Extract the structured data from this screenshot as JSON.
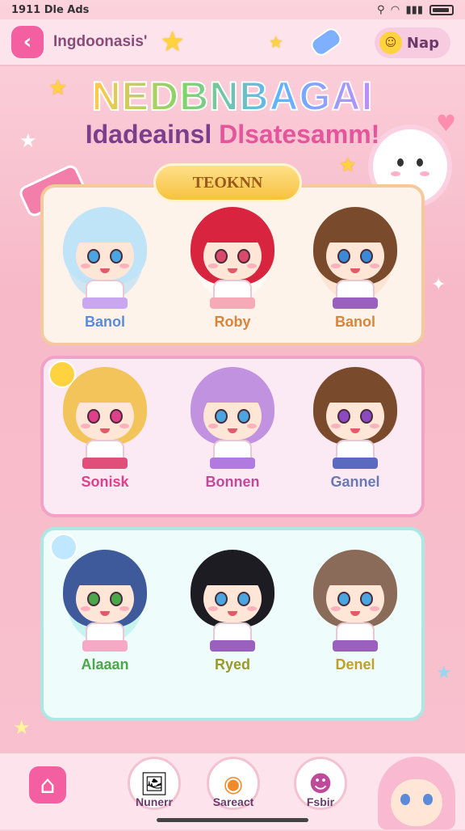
{
  "status": {
    "time": "1911 Dle Ads"
  },
  "topbar": {
    "app_name": "Ingdoonasis'",
    "nap_label": "Nap",
    "back_icon": "back-arrow-icon"
  },
  "titles": {
    "main": "NEDBNBAGAI",
    "sub_a": "Idadeainsl",
    "sub_b": "Dlsatesamm!"
  },
  "panel1": {
    "tag": "TEOKNN"
  },
  "characters": {
    "row1": [
      {
        "name": "Banol",
        "hair": "#bfe3f7",
        "eye": "#4aa6e0",
        "skirt": "#c8a7f0",
        "color": "#5a8ad8",
        "glow": "#a9d8f5"
      },
      {
        "name": "Roby",
        "hair": "#d8243f",
        "eye": "#d94a6a",
        "skirt": "#f6a9b6",
        "color": "#d8843a",
        "glow": "#ffffff"
      },
      {
        "name": "Banol",
        "hair": "#7a4a2c",
        "eye": "#3a8ad8",
        "skirt": "#9a60c0",
        "color": "#d8843a",
        "glow": "#ffd8c0"
      }
    ],
    "row2": [
      {
        "name": "Sonisk",
        "hair": "#f2c45a",
        "eye": "#e0408a",
        "skirt": "#e04f7a",
        "color": "#e0408a"
      },
      {
        "name": "Bonnen",
        "hair": "#c192e0",
        "eye": "#4aa6e0",
        "skirt": "#b07ae0",
        "color": "#c04a9a"
      },
      {
        "name": "Gannel",
        "hair": "#7a4a2c",
        "eye": "#8a4ac0",
        "skirt": "#5a6ac0",
        "color": "#6a7ab0"
      }
    ],
    "row3": [
      {
        "name": "Alaaan",
        "hair": "#3f5a9a",
        "eye": "#4aa84a",
        "skirt": "#f6a9c4",
        "color": "#4aa84a",
        "glow": "#a9ece8"
      },
      {
        "name": "Ryed",
        "hair": "#1c1c22",
        "eye": "#4aa6e0",
        "skirt": "#9a60c0",
        "color": "#9a9a2a"
      },
      {
        "name": "Denel",
        "hair": "#8a6a58",
        "eye": "#4aa6e0",
        "skirt": "#9a60c0",
        "color": "#c0a02a"
      }
    ]
  },
  "nav": {
    "item1": "Nunerr",
    "item2": "Sareact",
    "item3": "Fsbir"
  }
}
